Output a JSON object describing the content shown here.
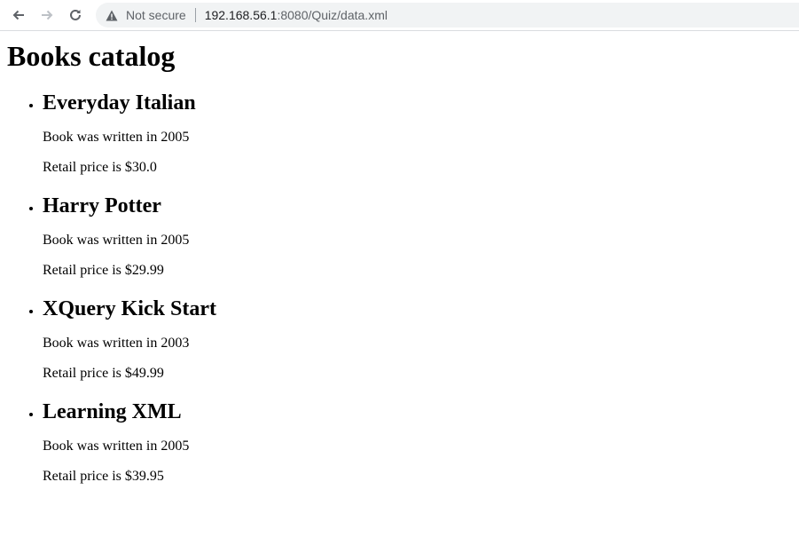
{
  "browser": {
    "security_label": "Not secure",
    "url_host": "192.168.56.1",
    "url_rest": ":8080/Quiz/data.xml"
  },
  "page": {
    "title": "Books catalog",
    "books": [
      {
        "title": "Everyday Italian",
        "year_line": "Book was written in 2005",
        "price_line": "Retail price is $30.0"
      },
      {
        "title": "Harry Potter",
        "year_line": "Book was written in 2005",
        "price_line": "Retail price is $29.99"
      },
      {
        "title": "XQuery Kick Start",
        "year_line": "Book was written in 2003",
        "price_line": "Retail price is $49.99"
      },
      {
        "title": "Learning XML",
        "year_line": "Book was written in 2005",
        "price_line": "Retail price is $39.95"
      }
    ]
  }
}
